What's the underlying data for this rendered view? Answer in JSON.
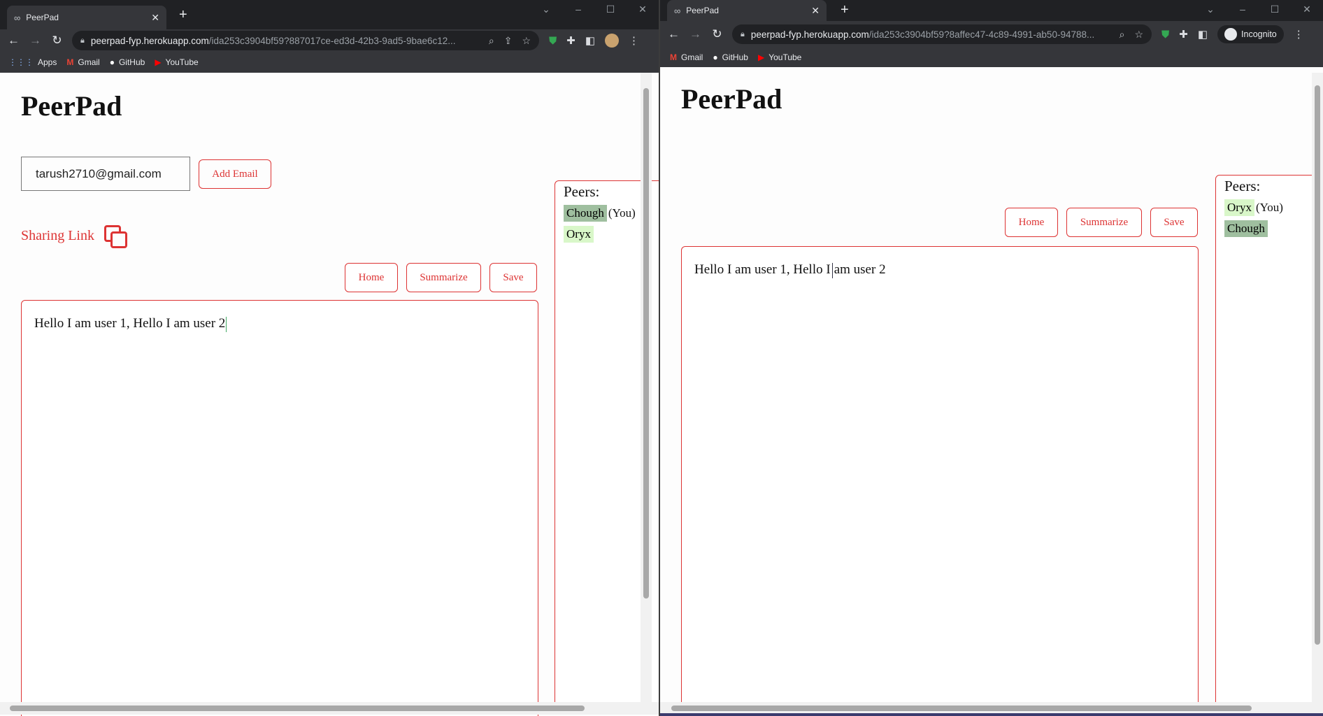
{
  "left": {
    "tab_title": "PeerPad",
    "url_host": "peerpad-fyp.herokuapp.com",
    "url_path": "/ida253c3904bf59?887017ce-ed3d-42b3-9ad5-9bae6c12...",
    "bookmarks": [
      "Apps",
      "Gmail",
      "GitHub",
      "YouTube"
    ],
    "app_title": "PeerPad",
    "email_value": "tarush2710@gmail.com",
    "add_email_label": "Add Email",
    "sharing_label": "Sharing Link",
    "buttons": {
      "home": "Home",
      "summarize": "Summarize",
      "save": "Save"
    },
    "editor_text": "Hello I am user 1, Hello I am user 2",
    "peers_label": "Peers:",
    "peers": [
      {
        "name": "Chough",
        "you": "(You)"
      },
      {
        "name": "Oryx"
      }
    ]
  },
  "right": {
    "tab_title": "PeerPad",
    "url_host": "peerpad-fyp.herokuapp.com",
    "url_path": "/ida253c3904bf59?8affec47-4c89-4991-ab50-94788...",
    "incognito_label": "Incognito",
    "bookmarks": [
      "Gmail",
      "GitHub",
      "YouTube"
    ],
    "app_title": "PeerPad",
    "buttons": {
      "home": "Home",
      "summarize": "Summarize",
      "save": "Save"
    },
    "editor_text_before": "Hello I am user 1, Hello I",
    "editor_text_after": "am user 2",
    "peers_label": "Peers:",
    "peers": [
      {
        "name": "Oryx",
        "you": "(You)"
      },
      {
        "name": "Chough"
      }
    ]
  },
  "icons": {
    "tab": "infinity-icon",
    "close": "close-icon",
    "new_tab": "plus-icon",
    "back": "back-arrow-icon",
    "forward": "forward-arrow-icon",
    "reload": "reload-icon",
    "lock": "lock-icon",
    "zoom": "zoom-icon",
    "share": "share-icon",
    "star": "star-icon",
    "shield": "shield-icon",
    "extensions": "puzzle-icon",
    "sidepanel": "side-panel-icon",
    "menu": "kebab-menu-icon",
    "copy": "copy-icon"
  },
  "colors": {
    "accent": "#dd3333",
    "peer_dark": "#9fbf9f",
    "peer_light": "#d9f7c9",
    "chrome_dark": "#202124",
    "chrome_toolbar": "#35363a"
  }
}
